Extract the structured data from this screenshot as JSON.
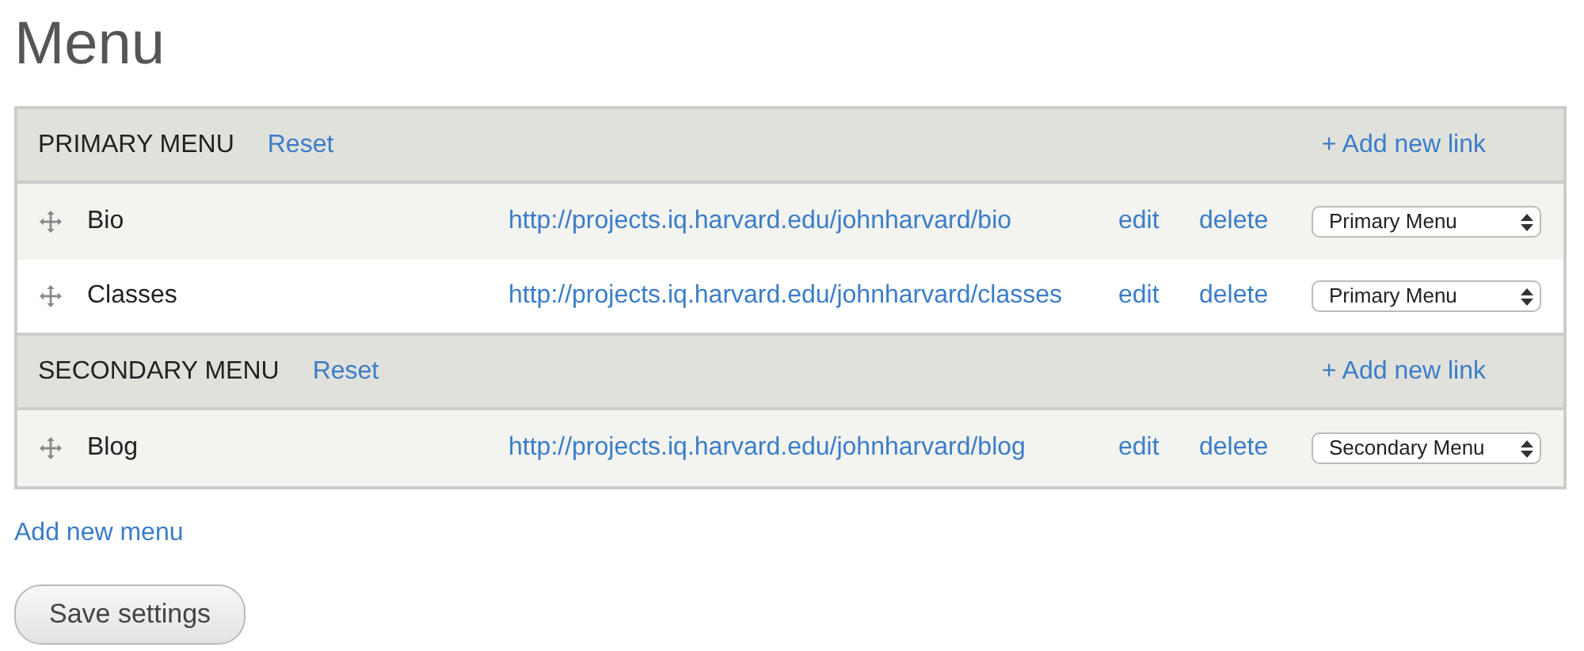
{
  "title": "Menu",
  "menus": [
    {
      "name": "PRIMARY MENU",
      "reset": "Reset",
      "add_link": "+ Add new link",
      "links": [
        {
          "title": "Bio",
          "url": "http://projects.iq.harvard.edu/johnharvard/bio",
          "edit": "edit",
          "delete": "delete",
          "menu": "Primary Menu"
        },
        {
          "title": "Classes",
          "url": "http://projects.iq.harvard.edu/johnharvard/classes",
          "edit": "edit",
          "delete": "delete",
          "menu": "Primary Menu"
        }
      ]
    },
    {
      "name": "SECONDARY MENU",
      "reset": "Reset",
      "add_link": "+ Add new link",
      "links": [
        {
          "title": "Blog",
          "url": "http://projects.iq.harvard.edu/johnharvard/blog",
          "edit": "edit",
          "delete": "delete",
          "menu": "Secondary Menu"
        }
      ]
    }
  ],
  "add_menu": "Add new menu",
  "save_button": "Save settings"
}
